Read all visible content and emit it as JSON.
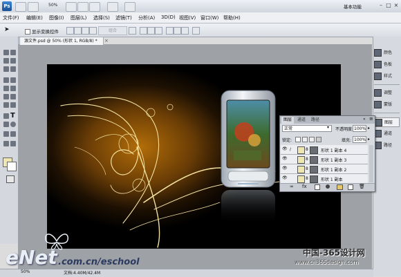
{
  "app": {
    "logo": "Ps",
    "zoom": "50%",
    "workspace": "基本功能"
  },
  "menubar": [
    "文件(F)",
    "编辑(E)",
    "图像(I)",
    "图层(L)",
    "选择(S)",
    "滤镜(T)",
    "分析(A)",
    "3D(D)",
    "视图(V)",
    "窗口(W)",
    "帮助(H)"
  ],
  "options": {
    "show_transform": "显示变换控件",
    "combine": "组合"
  },
  "document": {
    "tab_title": "源文件.psd @ 50% (形状 1, RGB/8) *",
    "close": "×"
  },
  "dock": [
    "颜色",
    "色板",
    "样式",
    "调整",
    "蒙版",
    "图层",
    "通道",
    "路径"
  ],
  "layers_panel": {
    "tabs": [
      "图层",
      "通道",
      "路径"
    ],
    "blend_mode": "正常",
    "opacity_label": "不透明度:",
    "opacity": "100%",
    "lock_label": "锁定:",
    "fill_label": "填充:",
    "fill": "100%",
    "layers": [
      "形状 1 副本 4",
      "形状 1 副本 3",
      "形状 1 副本 2",
      "形状 1 副本"
    ]
  },
  "status": {
    "zoom": "50%",
    "doc": "文档:4.40M/42.4M"
  },
  "watermarks": {
    "enet": "eNet",
    "enet_rest": ".com.cn/eschool",
    "cn365": "中国-365设计网",
    "cn365_url": "www.cn365design.com"
  },
  "colors": {
    "foreground": "#efe7b0",
    "background": "#ffffff",
    "canvas_glow": "#b26d08"
  }
}
